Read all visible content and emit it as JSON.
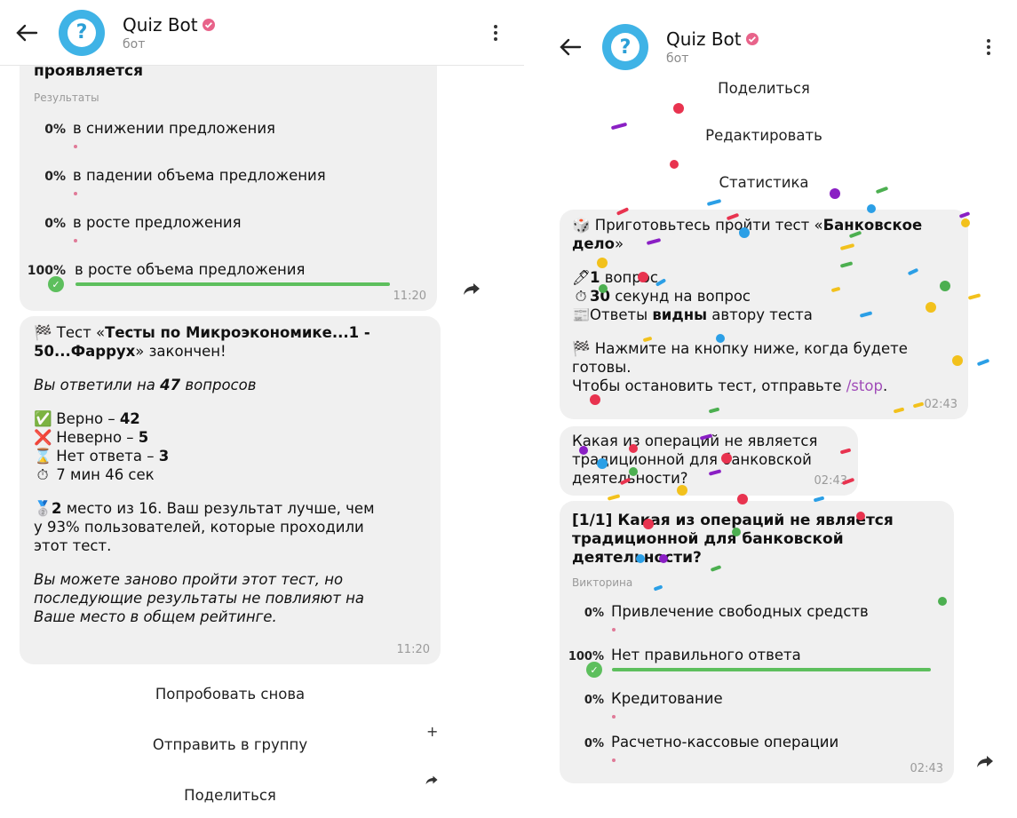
{
  "left": {
    "header": {
      "bot_name": "Quiz Bot",
      "bot_sub": "бот"
    },
    "poll": {
      "question_tail": "проявляется",
      "results_label": "Результаты",
      "options": [
        {
          "pct": "0%",
          "text": "в снижении предложения",
          "value": 0
        },
        {
          "pct": "0%",
          "text": "в падении объема предложения",
          "value": 0
        },
        {
          "pct": "0%",
          "text": "в росте предложения",
          "value": 0
        },
        {
          "pct": "100%",
          "text": "в росте объема предложения",
          "value": 100
        }
      ],
      "time": "11:20"
    },
    "result": {
      "line1_pre": "Тест «",
      "line1_bold": "Тесты по Микроэкономике...1 -",
      "line2_bold": "50...Фаррух",
      "line2_post": "» закончен!",
      "answered_pre": "Вы ответили на ",
      "answered_num": "47",
      "answered_post": " вопросов",
      "correct_label": "Верно – ",
      "correct_val": "42",
      "wrong_label": "Неверно – ",
      "wrong_val": "5",
      "noans_label": "Нет ответа – ",
      "noans_val": "3",
      "duration": "7 мин 46 сек",
      "place_line1_bold": "2",
      "place_line1_rest": " место из 16. Ваш результат лучше, чем",
      "place_line2": "у 93% пользователей, которые проходили",
      "place_line3": "этот тест.",
      "note_line1": "Вы можете заново пройти этот тест, но",
      "note_line2": "последующие результаты не повлияют на",
      "note_line3": "Ваше место в общем рейтинге.",
      "time": "11:20"
    },
    "actions": {
      "retry": "Попробовать снова",
      "send_group": "Отправить в группу",
      "share": "Поделиться"
    }
  },
  "right": {
    "header": {
      "bot_name": "Quiz Bot",
      "bot_sub": "бот"
    },
    "actions": {
      "share": "Поделиться",
      "edit": "Редактировать",
      "stats": "Статистика"
    },
    "intro": {
      "line1_pre": "Приготовьтесь пройти тест «",
      "line1_bold": "Банковское",
      "line2_bold": "дело",
      "line2_post": "»",
      "q_count_bold": "1",
      "q_count_rest": " вопрос",
      "seconds_bold": "30",
      "seconds_rest": " секунд на вопрос",
      "answers_pre": "Ответы ",
      "answers_bold": "видны",
      "answers_post": " автору теста",
      "press_line1": "Нажмите на кнопку ниже, когда будете",
      "press_line2": "готовы.",
      "stop_pre": "Чтобы остановить тест, отправьте ",
      "stop_cmd": "/stop",
      "stop_post": ".",
      "time": "02:43"
    },
    "question_msg": {
      "line1": "Какая из операций не является",
      "line2": "традиционной для банковской",
      "line3": "деятельности?",
      "time": "02:43"
    },
    "quiz": {
      "line1": "[1/1] Какая из операций не является",
      "line2": "традиционной для банковской",
      "line3": "деятельности?",
      "type": "Викторина",
      "options": [
        {
          "pct": "0%",
          "text": "Привлечение свободных средств",
          "value": 0
        },
        {
          "pct": "100%",
          "text": "Нет правильного ответа",
          "value": 100
        },
        {
          "pct": "0%",
          "text": "Кредитование",
          "value": 0
        },
        {
          "pct": "0%",
          "text": "Расчетно-кассовые операции",
          "value": 0
        }
      ],
      "time": "02:43"
    }
  },
  "colors": {
    "bubble": "#f0f0f0",
    "accent_green": "#5dbf5d",
    "avatar_blue": "#3fb3e6",
    "verify_pink": "#e8638a",
    "command_purple": "#a04cb8"
  }
}
